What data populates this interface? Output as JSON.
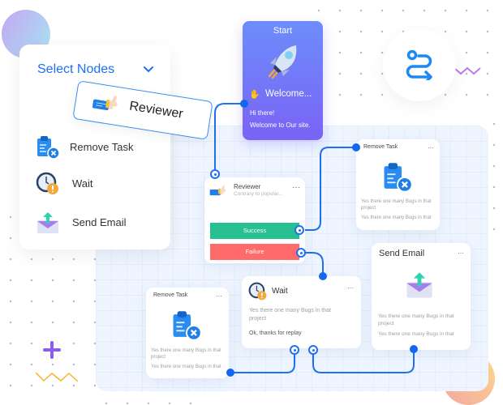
{
  "select_panel": {
    "title": "Select Nodes",
    "dragging_item": "Reviewer",
    "items": [
      {
        "label": "Remove Task",
        "icon": "clipboard-remove-icon"
      },
      {
        "label": "Wait",
        "icon": "clock-warning-icon"
      },
      {
        "label": "Send Email",
        "icon": "email-send-icon"
      }
    ]
  },
  "start_node": {
    "header": "Start",
    "greeting": "Welcome...",
    "line1": "Hi there!",
    "line2": "Welcome to Our site."
  },
  "reviewer_node": {
    "title": "Reviewer",
    "subtitle": "Contrary to popular...",
    "success_label": "Success",
    "failure_label": "Failure",
    "more": "···"
  },
  "remove_task_node_right": {
    "title": "Remove Task",
    "desc1": "Yes there one many Bugs in that project",
    "desc2": "Yes there one many Bugs in that",
    "more": "···"
  },
  "send_email_node": {
    "title": "Send Email",
    "desc1": "Yes there one many Bugs in that project",
    "desc2": "Yes there one many Bugs in that",
    "more": "···"
  },
  "wait_node": {
    "title": "Wait",
    "desc1": "Yes there one many Bugs in that project",
    "desc2": "Ok, thanks for replay",
    "more": "···"
  },
  "remove_task_node_left": {
    "title": "Remove Task",
    "desc1": "Yes there one many Bugs in that project",
    "desc2": "Yes there one many Bugs in that",
    "more": "···"
  },
  "colors": {
    "accent": "#1e6ff2",
    "success": "#27c093",
    "failure": "#ff6b6b",
    "start_gradient_top": "#6d8dfb",
    "start_gradient_bottom": "#7a63f5"
  }
}
